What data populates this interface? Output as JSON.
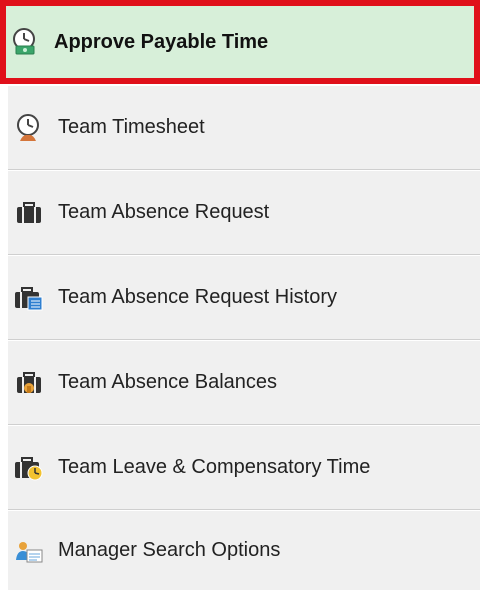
{
  "menu": {
    "items": [
      {
        "label": "Approve Payable Time",
        "icon": "clock-money-icon",
        "active": true
      },
      {
        "label": "Team Timesheet",
        "icon": "clock-team-icon",
        "active": false
      },
      {
        "label": "Team Absence Request",
        "icon": "briefcase-icon",
        "active": false
      },
      {
        "label": "Team Absence Request History",
        "icon": "briefcase-calendar-icon",
        "active": false
      },
      {
        "label": "Team Absence Balances",
        "icon": "briefcase-balance-icon",
        "active": false
      },
      {
        "label": "Team Leave & Compensatory Time",
        "icon": "briefcase-clock-icon",
        "active": false
      },
      {
        "label": "Manager Search Options",
        "icon": "manager-search-icon",
        "active": false
      }
    ]
  },
  "colors": {
    "active_bg": "#d7efd9",
    "active_border": "#e0101a",
    "item_bg": "#f0f0f0",
    "divider": "#cfcfcf"
  }
}
